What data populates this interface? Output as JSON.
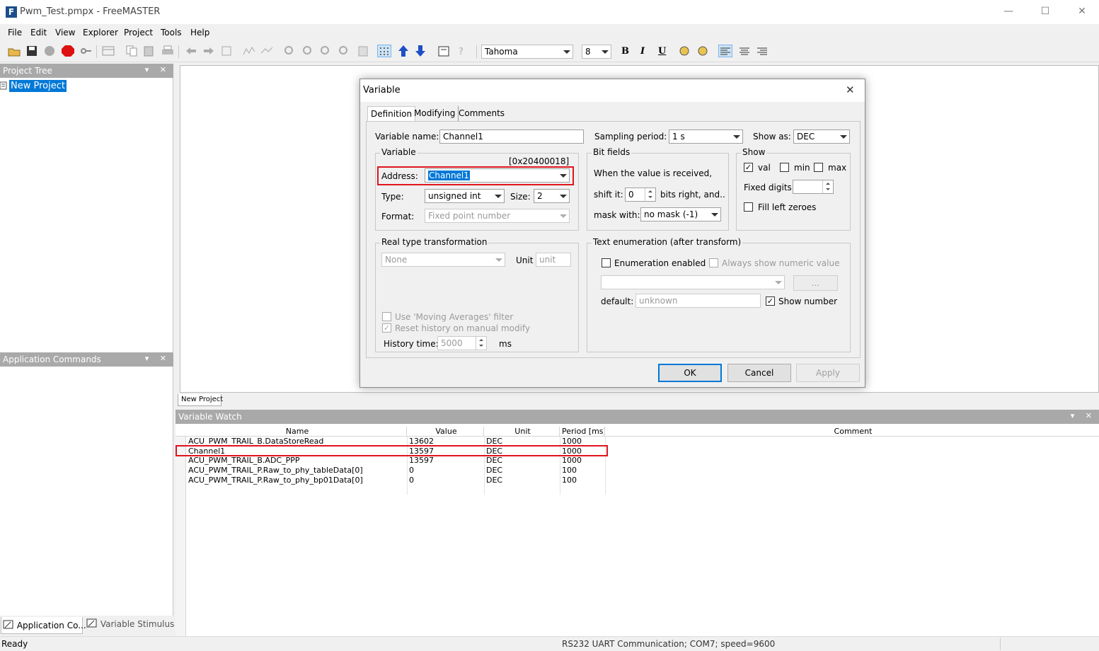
{
  "window": {
    "title": "Pwm_Test.pmpx - FreeMASTER",
    "icon_letter": "F",
    "controls": {
      "minimize": "—",
      "maximize": "☐",
      "close": "✕"
    }
  },
  "menu": [
    "File",
    "Edit",
    "View",
    "Explorer",
    "Project",
    "Tools",
    "Help"
  ],
  "toolbar": {
    "font_name": "Tahoma",
    "font_size": "8",
    "bold": "B",
    "italic": "I",
    "underline": "U"
  },
  "project_tree": {
    "title": "Project Tree",
    "header_buttons": "▾ ✕",
    "items": [
      "New Project"
    ]
  },
  "app_commands": {
    "title": "Application Commands",
    "header_buttons": "▾ ✕"
  },
  "bottom_tabs": [
    "Application Co...",
    "Variable Stimulus"
  ],
  "doc_tab": "New Project",
  "variable_watch": {
    "title": "Variable Watch",
    "header_buttons": "▾ ✕",
    "columns": [
      "Name",
      "Value",
      "Unit",
      "Period [ms]",
      "Comment"
    ],
    "rows": [
      {
        "name": "ACU_PWM_TRAIL_B.DataStoreRead",
        "value": "13602",
        "unit": "DEC",
        "period": "1000",
        "comment": ""
      },
      {
        "name": "Channel1",
        "value": "13597",
        "unit": "DEC",
        "period": "1000",
        "comment": ""
      },
      {
        "name": "ACU_PWM_TRAIL_B.ADC_PPP",
        "value": "13597",
        "unit": "DEC",
        "period": "1000",
        "comment": ""
      },
      {
        "name": "ACU_PWM_TRAIL_P.Raw_to_phy_tableData[0]",
        "value": "0",
        "unit": "DEC",
        "period": "100",
        "comment": ""
      },
      {
        "name": "ACU_PWM_TRAIL_P.Raw_to_phy_bp01Data[0]",
        "value": "0",
        "unit": "DEC",
        "period": "100",
        "comment": ""
      }
    ]
  },
  "dialog": {
    "title": "Variable",
    "close": "✕",
    "tabs": [
      "Definition",
      "Modifying",
      "Comments"
    ],
    "variable_name_label": "Variable name:",
    "variable_name_value": "Channel1",
    "sampling_period_label": "Sampling period:",
    "sampling_period_value": "1 s",
    "show_as_label": "Show as:",
    "show_as_value": "DEC",
    "variable_group": {
      "title": "Variable",
      "address_hint": "[0x20400018]",
      "address_label": "Address:",
      "address_value": "Channel1",
      "type_label": "Type:",
      "type_value": "unsigned int",
      "size_label": "Size:",
      "size_value": "2",
      "format_label": "Format:",
      "format_value": "Fixed point number"
    },
    "bitfields_group": {
      "title": "Bit fields",
      "text": "When the value is received,",
      "shift_label": "shift it:",
      "shift_value": "0",
      "shift_suffix": "bits right, and..",
      "mask_label": "mask with:",
      "mask_value": "no mask (-1)"
    },
    "show_group": {
      "title": "Show",
      "val_label": "val",
      "val_checked": true,
      "min_label": "min",
      "max_label": "max",
      "fixed_digits_label": "Fixed digits:",
      "fill_zeroes_label": "Fill left zeroes",
      "check_mark": "✓"
    },
    "real_type_group": {
      "title": "Real type transformation",
      "value": "None",
      "unit_label": "Unit",
      "unit_value": "unit",
      "moving_avg_label": "Use 'Moving Averages' filter",
      "reset_history_label": "Reset history on manual modify",
      "history_time_label": "History time:",
      "history_time_value": "5000",
      "history_unit": "ms"
    },
    "text_enum_group": {
      "title": "Text enumeration (after transform)",
      "enum_enabled_label": "Enumeration enabled",
      "always_numeric_label": "Always show numeric value",
      "dots_button": "...",
      "default_label": "default:",
      "default_value": "unknown",
      "show_number_label": "Show number"
    },
    "buttons": {
      "ok": "OK",
      "cancel": "Cancel",
      "apply": "Apply"
    }
  },
  "status": {
    "left": "Ready",
    "center": "RS232 UART Communication; COM7; speed=9600"
  },
  "colors": {
    "highlight_red": "#e0141e",
    "selection_blue": "#0078d7",
    "panel_header_gray": "#a9a9a9"
  }
}
